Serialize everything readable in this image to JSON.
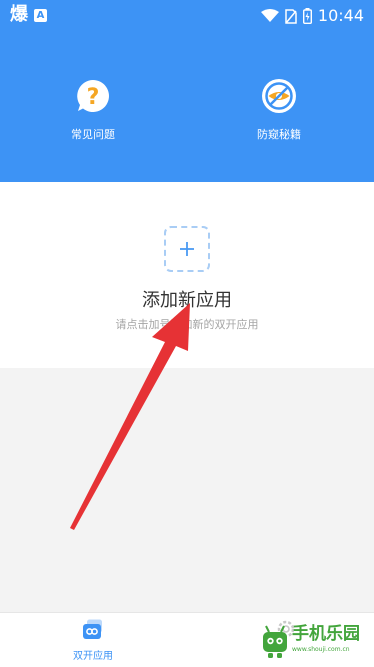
{
  "status_bar": {
    "left_glyph": "爆",
    "badge": "A",
    "time": "10:44"
  },
  "header": {
    "faq": {
      "label": "常见问题",
      "icon": "question-bubble-icon",
      "glyph": "?"
    },
    "anti_peep": {
      "label": "防窥秘籍",
      "icon": "no-eye-icon"
    }
  },
  "add_app": {
    "title": "添加新应用",
    "hint": "请点击加号添加新的双开应用",
    "icon": "plus-icon"
  },
  "bottom_nav": [
    {
      "label": "双开应用",
      "icon": "dual-app-icon",
      "active": true
    },
    {
      "label": "",
      "icon": "gear-icon",
      "active": false
    }
  ],
  "watermark": {
    "title": "手机乐园",
    "subtitle": "www.shouji.com.cn"
  },
  "colors": {
    "primary": "#3d93f5",
    "accent_orange": "#f5a623",
    "arrow_red": "#e63235",
    "watermark_green": "#43a53c"
  }
}
